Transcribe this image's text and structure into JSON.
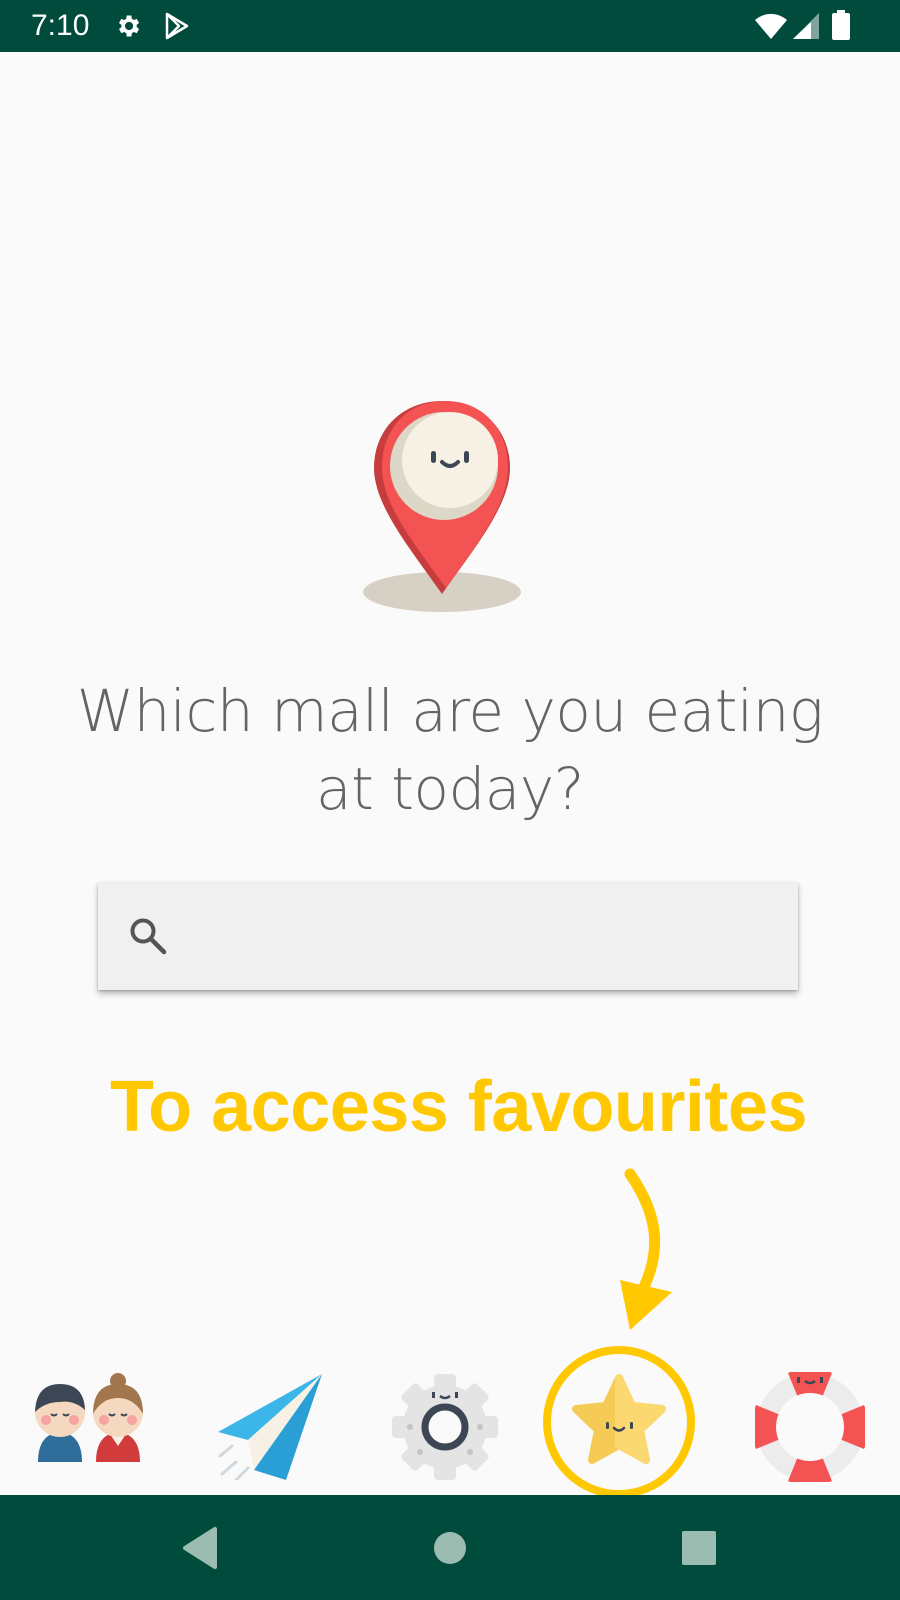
{
  "status_bar": {
    "time": "7:10",
    "icons": [
      "settings-icon",
      "play-store-icon",
      "wifi-icon",
      "signal-icon",
      "battery-icon"
    ]
  },
  "main": {
    "illustration": "location-pin-icon",
    "headline": "Which mall are you eating at today?",
    "search": {
      "placeholder": "",
      "value": "",
      "icon": "search-icon"
    },
    "hint_text": "To access favourites"
  },
  "bottom_nav": {
    "items": [
      {
        "name": "people",
        "icon": "people-icon"
      },
      {
        "name": "send",
        "icon": "paper-plane-icon"
      },
      {
        "name": "settings",
        "icon": "gear-icon"
      },
      {
        "name": "favourites",
        "icon": "star-icon",
        "highlighted": true
      },
      {
        "name": "help",
        "icon": "lifebuoy-icon"
      }
    ]
  },
  "system_nav": {
    "icons": [
      "back-icon",
      "home-icon",
      "recents-icon"
    ]
  },
  "colors": {
    "status_bar": "#004b3b",
    "background": "#fafafa",
    "headline_text": "#646464",
    "search_bg": "#f0f0f0",
    "hint": "#ffc800",
    "pin": "#f45353"
  }
}
